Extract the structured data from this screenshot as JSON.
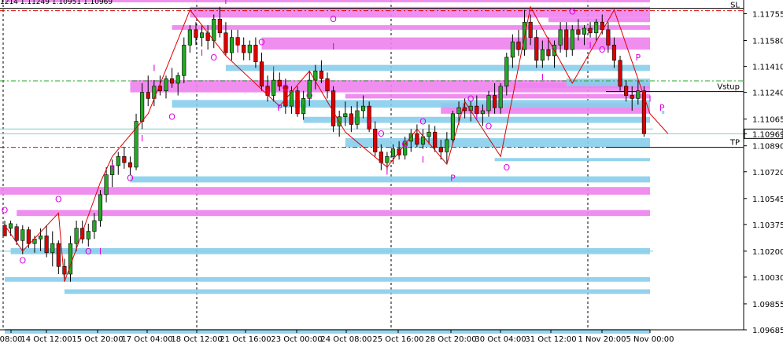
{
  "header": {
    "ohlc_text": "1214 1.11249 1.10951 1.10969"
  },
  "chart_data": {
    "type": "candlestick",
    "y_axis_labels": [
      "1.11755",
      "1.11580",
      "1.11410",
      "1.11240",
      "1.11065",
      "1.10969",
      "1.10890",
      "1.10720",
      "1.10545",
      "1.10375",
      "1.10200",
      "1.10030",
      "1.09855",
      "1.09685"
    ],
    "ylim": [
      1.09685,
      1.11845
    ],
    "x_axis_labels": [
      "08:00",
      "14 Oct 12:00",
      "15 Oct 20:00",
      "17 Oct 04:00",
      "18 Oct 12:00",
      "21 Oct 16:00",
      "23 Oct 00:00",
      "24 Oct 08:00",
      "25 Oct 16:00",
      "28 Oct 20:00",
      "30 Oct 04:00",
      "31 Oct 12:00",
      "1 Nov 20:00",
      "5 Nov 00:00"
    ],
    "current_price": "1.10969",
    "line_labels": {
      "sl": "SL",
      "vstup": "Vstup",
      "tp": "TP"
    },
    "levels": {
      "sl": 1.11775,
      "vstup": 1.11245,
      "tp": 1.1088,
      "green_dash": 1.11315
    },
    "candles": [
      [
        1.1037,
        1.104,
        1.1033,
        1.103
      ],
      [
        1.1035,
        1.104,
        1.103,
        1.1038
      ],
      [
        1.1036,
        1.1038,
        1.1024,
        1.1027
      ],
      [
        1.1027,
        1.1037,
        1.1018,
        1.1034
      ],
      [
        1.1034,
        1.1036,
        1.1022,
        1.1025
      ],
      [
        1.1025,
        1.103,
        1.1019,
        1.1028
      ],
      [
        1.1028,
        1.1035,
        1.102,
        1.103
      ],
      [
        1.103,
        1.1037,
        1.1016,
        1.1019
      ],
      [
        1.1019,
        1.1033,
        1.101,
        1.1025
      ],
      [
        1.1025,
        1.1027,
        1.1005,
        1.101
      ],
      [
        1.101,
        1.1015,
        1.1002,
        1.1005
      ],
      [
        1.1005,
        1.103,
        1.1,
        1.1025
      ],
      [
        1.1025,
        1.104,
        1.102,
        1.1035
      ],
      [
        1.1035,
        1.104,
        1.1025,
        1.1028
      ],
      [
        1.1028,
        1.1038,
        1.1023,
        1.1033
      ],
      [
        1.1033,
        1.1045,
        1.1028,
        1.104
      ],
      [
        1.104,
        1.106,
        1.1036,
        1.1057
      ],
      [
        1.1057,
        1.1075,
        1.1052,
        1.107
      ],
      [
        1.107,
        1.108,
        1.1062,
        1.1076
      ],
      [
        1.1076,
        1.1085,
        1.107,
        1.1082
      ],
      [
        1.1082,
        1.1088,
        1.1074,
        1.1078
      ],
      [
        1.1078,
        1.1082,
        1.107,
        1.1075
      ],
      [
        1.1075,
        1.111,
        1.1073,
        1.1105
      ],
      [
        1.1105,
        1.113,
        1.11,
        1.1124
      ],
      [
        1.1124,
        1.1135,
        1.1115,
        1.112
      ],
      [
        1.112,
        1.1132,
        1.1115,
        1.1128
      ],
      [
        1.1128,
        1.1135,
        1.1122,
        1.1125
      ],
      [
        1.1125,
        1.1135,
        1.112,
        1.1133
      ],
      [
        1.1133,
        1.114,
        1.1127,
        1.113
      ],
      [
        1.113,
        1.1137,
        1.1122,
        1.1135
      ],
      [
        1.1135,
        1.116,
        1.113,
        1.1155
      ],
      [
        1.1155,
        1.1168,
        1.115,
        1.1165
      ],
      [
        1.1165,
        1.117,
        1.1155,
        1.116
      ],
      [
        1.116,
        1.1168,
        1.1154,
        1.1163
      ],
      [
        1.1163,
        1.1168,
        1.1152,
        1.1158
      ],
      [
        1.1158,
        1.1175,
        1.1153,
        1.1172
      ],
      [
        1.1172,
        1.118,
        1.116,
        1.1163
      ],
      [
        1.1163,
        1.117,
        1.1148,
        1.115
      ],
      [
        1.115,
        1.1165,
        1.1145,
        1.116
      ],
      [
        1.116,
        1.1165,
        1.115,
        1.1155
      ],
      [
        1.1155,
        1.116,
        1.1145,
        1.115
      ],
      [
        1.115,
        1.1158,
        1.1145,
        1.1155
      ],
      [
        1.1155,
        1.116,
        1.114,
        1.1144
      ],
      [
        1.1144,
        1.115,
        1.1125,
        1.1128
      ],
      [
        1.1128,
        1.1135,
        1.1118,
        1.1122
      ],
      [
        1.1122,
        1.1138,
        1.1118,
        1.1132
      ],
      [
        1.1132,
        1.1137,
        1.1125,
        1.1128
      ],
      [
        1.1128,
        1.1133,
        1.111,
        1.1115
      ],
      [
        1.1115,
        1.1128,
        1.111,
        1.1125
      ],
      [
        1.1125,
        1.1128,
        1.1108,
        1.111
      ],
      [
        1.111,
        1.1125,
        1.1106,
        1.112
      ],
      [
        1.112,
        1.1138,
        1.1115,
        1.1132
      ],
      [
        1.1132,
        1.1142,
        1.1126,
        1.1138
      ],
      [
        1.1138,
        1.1145,
        1.113,
        1.1133
      ],
      [
        1.1133,
        1.1137,
        1.112,
        1.1125
      ],
      [
        1.1125,
        1.1128,
        1.1098,
        1.1102
      ],
      [
        1.1102,
        1.1112,
        1.1095,
        1.1108
      ],
      [
        1.1108,
        1.1118,
        1.1102,
        1.111
      ],
      [
        1.111,
        1.1115,
        1.1098,
        1.1103
      ],
      [
        1.1103,
        1.1118,
        1.11,
        1.1112
      ],
      [
        1.1112,
        1.1122,
        1.1107,
        1.1115
      ],
      [
        1.1115,
        1.1118,
        1.1098,
        1.11
      ],
      [
        1.11,
        1.1105,
        1.1082,
        1.1085
      ],
      [
        1.1085,
        1.109,
        1.1073,
        1.1078
      ],
      [
        1.1078,
        1.1085,
        1.1073,
        1.1082
      ],
      [
        1.1082,
        1.109,
        1.1077,
        1.1087
      ],
      [
        1.1087,
        1.1092,
        1.108,
        1.1083
      ],
      [
        1.1083,
        1.1095,
        1.108,
        1.1092
      ],
      [
        1.1092,
        1.11,
        1.1085,
        1.1097
      ],
      [
        1.1097,
        1.1103,
        1.1088,
        1.109
      ],
      [
        1.109,
        1.11,
        1.1087,
        1.1095
      ],
      [
        1.1095,
        1.1103,
        1.109,
        1.1098
      ],
      [
        1.1098,
        1.1102,
        1.1085,
        1.1088
      ],
      [
        1.1088,
        1.1093,
        1.108,
        1.1085
      ],
      [
        1.1085,
        1.1098,
        1.1077,
        1.1093
      ],
      [
        1.1093,
        1.1112,
        1.109,
        1.111
      ],
      [
        1.111,
        1.1118,
        1.1103,
        1.1114
      ],
      [
        1.1114,
        1.112,
        1.1107,
        1.1112
      ],
      [
        1.1112,
        1.1118,
        1.1105,
        1.1115
      ],
      [
        1.1115,
        1.1122,
        1.1108,
        1.111
      ],
      [
        1.111,
        1.1116,
        1.1102,
        1.1112
      ],
      [
        1.1112,
        1.1125,
        1.1108,
        1.1122
      ],
      [
        1.1122,
        1.113,
        1.111,
        1.1114
      ],
      [
        1.1114,
        1.113,
        1.111,
        1.1128
      ],
      [
        1.1128,
        1.115,
        1.1122,
        1.1147
      ],
      [
        1.1147,
        1.1162,
        1.114,
        1.1157
      ],
      [
        1.1157,
        1.1165,
        1.1148,
        1.1152
      ],
      [
        1.1152,
        1.1178,
        1.1148,
        1.117
      ],
      [
        1.117,
        1.1175,
        1.1155,
        1.116
      ],
      [
        1.116,
        1.1165,
        1.114,
        1.1145
      ],
      [
        1.1145,
        1.1158,
        1.114,
        1.1152
      ],
      [
        1.1152,
        1.116,
        1.1145,
        1.1148
      ],
      [
        1.1148,
        1.1158,
        1.114,
        1.1155
      ],
      [
        1.1155,
        1.117,
        1.115,
        1.1165
      ],
      [
        1.1165,
        1.117,
        1.1147,
        1.1152
      ],
      [
        1.1152,
        1.1168,
        1.1148,
        1.1165
      ],
      [
        1.1165,
        1.1172,
        1.1158,
        1.1162
      ],
      [
        1.1162,
        1.1168,
        1.1155,
        1.1166
      ],
      [
        1.1166,
        1.117,
        1.116,
        1.1163
      ],
      [
        1.1163,
        1.1172,
        1.1158,
        1.117
      ],
      [
        1.117,
        1.1175,
        1.1162,
        1.1165
      ],
      [
        1.1165,
        1.117,
        1.115,
        1.1155
      ],
      [
        1.1155,
        1.116,
        1.114,
        1.1145
      ],
      [
        1.1145,
        1.1148,
        1.1125,
        1.1128
      ],
      [
        1.1128,
        1.1132,
        1.1118,
        1.1122
      ],
      [
        1.1122,
        1.1128,
        1.1112,
        1.112
      ],
      [
        1.112,
        1.1132,
        1.1116,
        1.1125
      ],
      [
        1.1125,
        1.1128,
        1.1095,
        1.1097
      ]
    ],
    "zigzag": [
      [
        0,
        1.1037
      ],
      [
        3,
        1.102
      ],
      [
        9,
        1.1045
      ],
      [
        10,
        1.1
      ],
      [
        16,
        1.1065
      ],
      [
        18,
        1.1082
      ],
      [
        24,
        1.111
      ],
      [
        31,
        1.1178
      ],
      [
        37,
        1.1148
      ],
      [
        46,
        1.1115
      ],
      [
        51,
        1.1138
      ],
      [
        57,
        1.1098
      ],
      [
        64,
        1.1075
      ],
      [
        69,
        1.11
      ],
      [
        74,
        1.1077
      ],
      [
        77,
        1.1118
      ],
      [
        83,
        1.1082
      ],
      [
        88,
        1.118
      ],
      [
        95,
        1.113
      ],
      [
        102,
        1.1178
      ],
      [
        108,
        1.111
      ],
      [
        111,
        1.1097
      ]
    ],
    "pink_zones": [
      [
        0,
        1.1188,
        1.1183
      ],
      [
        -2,
        1.1062,
        1.1057
      ],
      [
        2,
        1.1047,
        1.1043
      ],
      [
        21,
        1.1132,
        1.1124
      ],
      [
        31,
        1.118,
        1.1173
      ],
      [
        28,
        1.1168,
        1.1165
      ],
      [
        43,
        1.116,
        1.1152
      ],
      [
        57,
        1.1123,
        1.112
      ],
      [
        73,
        1.1117,
        1.111
      ],
      [
        85,
        1.113,
        1.1127
      ],
      [
        91,
        1.1173,
        1.117
      ]
    ],
    "blue_zones": [
      [
        0,
        1.1003,
        1.1
      ],
      [
        1,
        1.1022,
        1.1018
      ],
      [
        28,
        1.1119,
        1.1114
      ],
      [
        37,
        1.1142,
        1.1138
      ],
      [
        50,
        1.1108,
        1.1104
      ],
      [
        57,
        1.1094,
        1.1088
      ],
      [
        21,
        1.1069,
        1.1065
      ],
      [
        10,
        1.0995,
        1.0992
      ],
      [
        0,
        1.0969,
        1.0966
      ],
      [
        94,
        1.1133,
        1.1128
      ],
      [
        110,
        1.1112,
        1.111
      ],
      [
        82,
        1.1081,
        1.108
      ]
    ],
    "signals": [
      {
        "i": 0,
        "p": 1.1045,
        "t": "O"
      },
      {
        "i": 3,
        "p": 1.1012,
        "t": "O"
      },
      {
        "i": 9,
        "p": 1.1052,
        "t": "O"
      },
      {
        "i": 14,
        "p": 1.1018,
        "t": "O"
      },
      {
        "i": 16,
        "p": 1.1018,
        "t": "I"
      },
      {
        "i": 18,
        "p": 1.1073,
        "t": "I"
      },
      {
        "i": 21,
        "p": 1.1066,
        "t": "O"
      },
      {
        "i": 23,
        "p": 1.1092,
        "t": "I"
      },
      {
        "i": 28,
        "p": 1.1106,
        "t": "O"
      },
      {
        "i": 25,
        "p": 1.1138,
        "t": "I"
      },
      {
        "i": 33,
        "p": 1.1148,
        "t": "I"
      },
      {
        "i": 35,
        "p": 1.1145,
        "t": "O"
      },
      {
        "i": 37,
        "p": 1.1182,
        "t": "I"
      },
      {
        "i": 39,
        "p": 1.115,
        "t": "I"
      },
      {
        "i": 43,
        "p": 1.1155,
        "t": "O"
      },
      {
        "i": 45,
        "p": 1.1137,
        "t": "I"
      },
      {
        "i": 47,
        "p": 1.1125,
        "t": "O"
      },
      {
        "i": 44,
        "p": 1.1122,
        "t": "I"
      },
      {
        "i": 46,
        "p": 1.1112,
        "t": "P"
      },
      {
        "i": 50,
        "p": 1.1112,
        "t": "I"
      },
      {
        "i": 51,
        "p": 1.112,
        "t": "O"
      },
      {
        "i": 55,
        "p": 1.117,
        "t": "O"
      },
      {
        "i": 55,
        "p": 1.1152,
        "t": "I"
      },
      {
        "i": 59,
        "p": 1.1107,
        "t": "I"
      },
      {
        "i": 61,
        "p": 1.1102,
        "t": "I"
      },
      {
        "i": 63,
        "p": 1.1095,
        "t": "O"
      },
      {
        "i": 64,
        "p": 1.107,
        "t": "I"
      },
      {
        "i": 67,
        "p": 1.1088,
        "t": "O"
      },
      {
        "i": 70,
        "p": 1.1103,
        "t": "O"
      },
      {
        "i": 70,
        "p": 1.1078,
        "t": "I"
      },
      {
        "i": 75,
        "p": 1.1066,
        "t": "P"
      },
      {
        "i": 78,
        "p": 1.1118,
        "t": "O"
      },
      {
        "i": 79,
        "p": 1.1106,
        "t": "I"
      },
      {
        "i": 81,
        "p": 1.11,
        "t": "O"
      },
      {
        "i": 84,
        "p": 1.1073,
        "t": "O"
      },
      {
        "i": 88,
        "p": 1.1188,
        "t": "O"
      },
      {
        "i": 90,
        "p": 1.1132,
        "t": "I"
      },
      {
        "i": 95,
        "p": 1.1175,
        "t": "O"
      },
      {
        "i": 98,
        "p": 1.1153,
        "t": "I"
      },
      {
        "i": 100,
        "p": 1.115,
        "t": "O"
      },
      {
        "i": 102,
        "p": 1.1188,
        "t": "O"
      },
      {
        "i": 106,
        "p": 1.1145,
        "t": "P"
      },
      {
        "i": 108,
        "p": 1.1118,
        "t": "I"
      },
      {
        "i": 110,
        "p": 1.1112,
        "t": "P"
      }
    ]
  }
}
